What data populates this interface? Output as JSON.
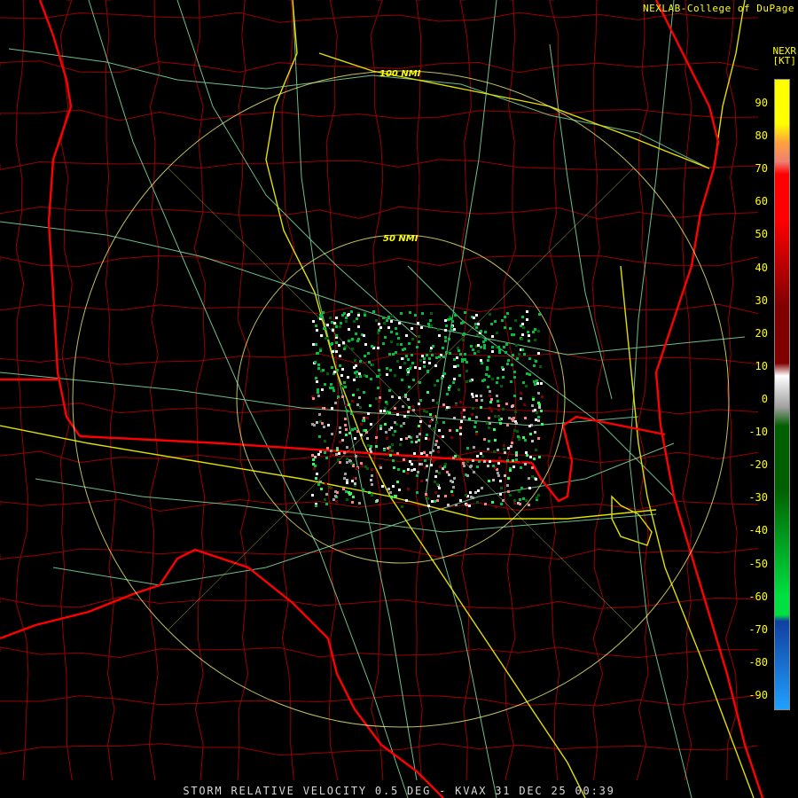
{
  "header": {
    "credit": "NEXLAB-College of DuPage",
    "product_line1": "NEXR",
    "product_line2": "[KT]"
  },
  "rings": [
    {
      "label": "50 NMI"
    },
    {
      "label": "100 NMI"
    }
  ],
  "legend": {
    "ticks": [
      "90",
      "80",
      "70",
      "60",
      "50",
      "40",
      "30",
      "20",
      "10",
      "0",
      "-10",
      "-20",
      "-30",
      "-40",
      "-50",
      "-60",
      "-70",
      "-80",
      "-90"
    ],
    "colors": {
      "top": "#ffff00",
      "orange": "#ffa040",
      "salmon": "#f08070",
      "red": "#ff0000",
      "dark_red": "#800000",
      "gray": "#a0a0a0",
      "dark_green": "#006000",
      "green": "#00e040",
      "dark_blue": "#1040a0",
      "light_blue": "#20a0ff"
    }
  },
  "footer": {
    "caption": "STORM RELATIVE VELOCITY 0.5 DEG - KVAX 31 DEC 25 00:39"
  },
  "map_colors": {
    "state_border": "#ff0000",
    "county_border": "#a00000",
    "highway": "#80e0a0",
    "interstate": "#e0e000",
    "range_ring": "#ffff80"
  }
}
